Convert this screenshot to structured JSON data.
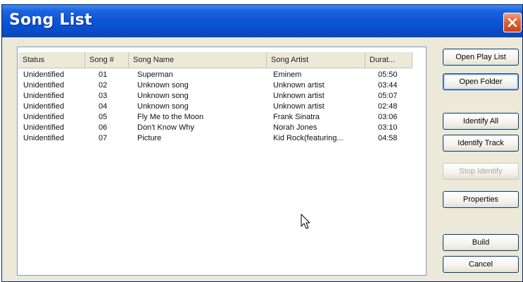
{
  "window": {
    "title": "Song List"
  },
  "list": {
    "columns": [
      "Status",
      "Song #",
      "Song Name",
      "Song Artist",
      "Durat..."
    ],
    "rows": [
      [
        "Unidentified",
        "01",
        "Superman",
        "Eminem",
        "05:50"
      ],
      [
        "Unidentified",
        "02",
        "Unknown song",
        "Unknown artist",
        "03:44"
      ],
      [
        "Unidentified",
        "03",
        "Unknown song",
        "Unknown artist",
        "05:07"
      ],
      [
        "Unidentified",
        "04",
        "Unknown song",
        "Unknown artist",
        "02:48"
      ],
      [
        "Unidentified",
        "05",
        "Fly Me to the Moon",
        "Frank Sinatra",
        "03:06"
      ],
      [
        "Unidentified",
        "06",
        "Don't Know Why",
        "Norah Jones",
        "03:10"
      ],
      [
        "Unidentified",
        "07",
        "Picture",
        "Kid Rock(featuring...",
        "04:58"
      ]
    ]
  },
  "buttons": {
    "open_play_list": "Open Play List",
    "open_folder": "Open Folder",
    "identify_all": "Identify All",
    "identify_track": "Identify Track",
    "stop_identify": "Stop Identify",
    "properties": "Properties",
    "build": "Build",
    "cancel": "Cancel"
  },
  "icons": {
    "close": "close-icon",
    "cursor": "mouse-pointer-icon"
  },
  "colors": {
    "titlebar": "#0b55d6",
    "close_button": "#e06436",
    "dialog_bg": "#ece9d8"
  }
}
